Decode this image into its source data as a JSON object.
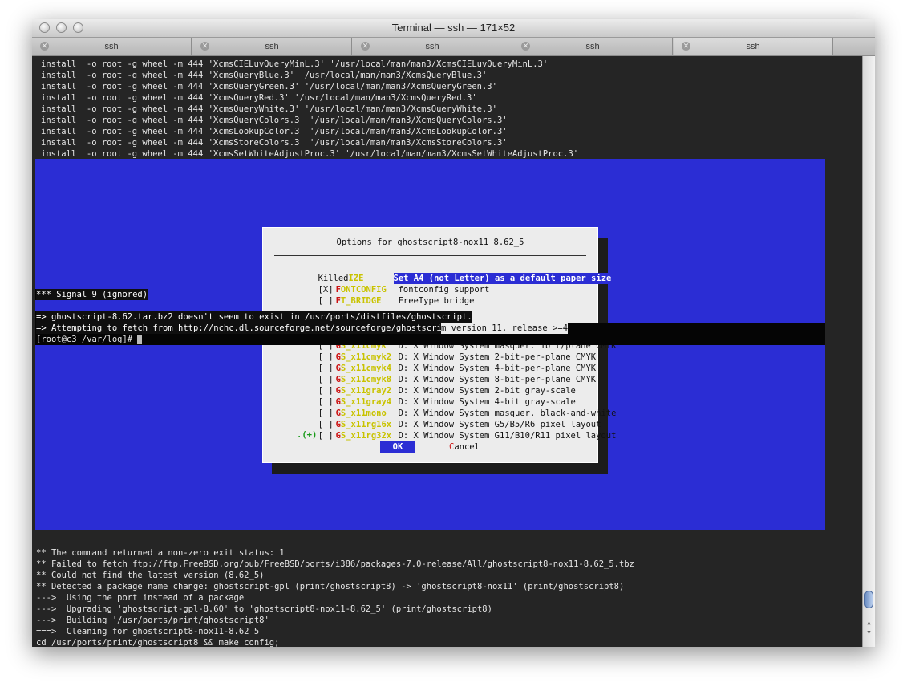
{
  "window": {
    "title": "Terminal — ssh — 171×52"
  },
  "tabs": [
    {
      "label": "ssh"
    },
    {
      "label": "ssh"
    },
    {
      "label": "ssh"
    },
    {
      "label": "ssh"
    },
    {
      "label": "ssh"
    }
  ],
  "terminal": {
    "top_lines": [
      "install  -o root -g wheel -m 444 'XcmsCIELuvQueryMinL.3' '/usr/local/man/man3/XcmsCIELuvQueryMinL.3'",
      "install  -o root -g wheel -m 444 'XcmsQueryBlue.3' '/usr/local/man/man3/XcmsQueryBlue.3'",
      "install  -o root -g wheel -m 444 'XcmsQueryGreen.3' '/usr/local/man/man3/XcmsQueryGreen.3'",
      "install  -o root -g wheel -m 444 'XcmsQueryRed.3' '/usr/local/man/man3/XcmsQueryRed.3'",
      "install  -o root -g wheel -m 444 'XcmsQueryWhite.3' '/usr/local/man/man3/XcmsQueryWhite.3'",
      "install  -o root -g wheel -m 444 'XcmsQueryColors.3' '/usr/local/man/man3/XcmsQueryColors.3'",
      "install  -o root -g wheel -m 444 'XcmsLookupColor.3' '/usr/local/man/man3/XcmsLookupColor.3'",
      "install  -o root -g wheel -m 444 'XcmsStoreColors.3' '/usr/local/man/man3/XcmsStoreColors.3'",
      "install  -o root -g wheel -m 444 'XcmsSetWhiteAdjustProc.3' '/usr/local/man/man3/XcmsSetWhiteAdjustProc.3'"
    ],
    "signal_line": "*** Signal 9 (ignored)",
    "fetch_line_1": "=> ghostscript-8.62.tar.bz2 doesn't seem to exist in /usr/ports/distfiles/ghostscript.",
    "fetch_line_2a": "=> Attempting to fetch from http://nchc.dl.sourceforge.net/sourceforge/ghostscript/.",
    "fetch_line_2b": "m version 11, release >=4",
    "prompt_line": "[root@c3 /var/log]# ",
    "bottom_lines": [
      "** The command returned a non-zero exit status: 1",
      "** Failed to fetch ftp://ftp.FreeBSD.org/pub/FreeBSD/ports/i386/packages-7.0-release/All/ghostscript8-nox11-8.62_5.tbz",
      "** Could not find the latest version (8.62_5)",
      "** Detected a package name change: ghostscript-gpl (print/ghostscript8) -> 'ghostscript8-nox11' (print/ghostscript8)",
      "--->  Using the port instead of a package",
      "--->  Upgrading 'ghostscript-gpl-8.60' to 'ghostscript8-nox11-8.62_5' (print/ghostscript8)",
      "--->  Building '/usr/ports/print/ghostscript8'",
      "===>  Cleaning for ghostscript8-nox11-8.62_5",
      "cd /usr/ports/print/ghostscript8 && make config;"
    ]
  },
  "dialog": {
    "title": "Options for ghostscript8-nox11 8.62_5",
    "selected_row": {
      "prefix": "Killed",
      "name_rest": "IZE",
      "desc": "Set A4 (not Letter) as a default paper size"
    },
    "rows": [
      {
        "check": "[X]",
        "first": "F",
        "rest": "ONTCONFIG",
        "desc": "fontconfig support"
      },
      {
        "check": "[ ]",
        "first": "F",
        "rest": "T_BRIDGE",
        "desc": "FreeType bridge"
      }
    ],
    "rows_lower": [
      {
        "check": "[ ]",
        "first": "G",
        "rest": "S_x11cmyk",
        "desc": "D: X Window System masquer. 1bit/plane CMYK"
      },
      {
        "check": "[ ]",
        "first": "G",
        "rest": "S_x11cmyk2",
        "desc": "D: X Window System 2-bit-per-plane CMYK"
      },
      {
        "check": "[ ]",
        "first": "G",
        "rest": "S_x11cmyk4",
        "desc": "D: X Window System 4-bit-per-plane CMYK"
      },
      {
        "check": "[ ]",
        "first": "G",
        "rest": "S_x11cmyk8",
        "desc": "D: X Window System 8-bit-per-plane CMYK"
      },
      {
        "check": "[ ]",
        "first": "G",
        "rest": "S_x11gray2",
        "desc": "D: X Window System 2-bit gray-scale"
      },
      {
        "check": "[ ]",
        "first": "G",
        "rest": "S_x11gray4",
        "desc": "D: X Window System 4-bit gray-scale"
      },
      {
        "check": "[ ]",
        "first": "G",
        "rest": "S_x11mono",
        "desc": "D: X Window System masquer. black-and-white"
      },
      {
        "check": "[ ]",
        "first": "G",
        "rest": "S_x11rg16x",
        "desc": "D: X Window System G5/B5/R6 pixel layout"
      },
      {
        "check": "[ ]",
        "first": "G",
        "rest": "S_x11rg32x",
        "desc": "D: X Window System G11/B10/R11 pixel layout"
      }
    ],
    "more_indicator": ".(+)",
    "ok_label": "OK",
    "cancel_first": "C",
    "cancel_rest": "ancel"
  }
}
